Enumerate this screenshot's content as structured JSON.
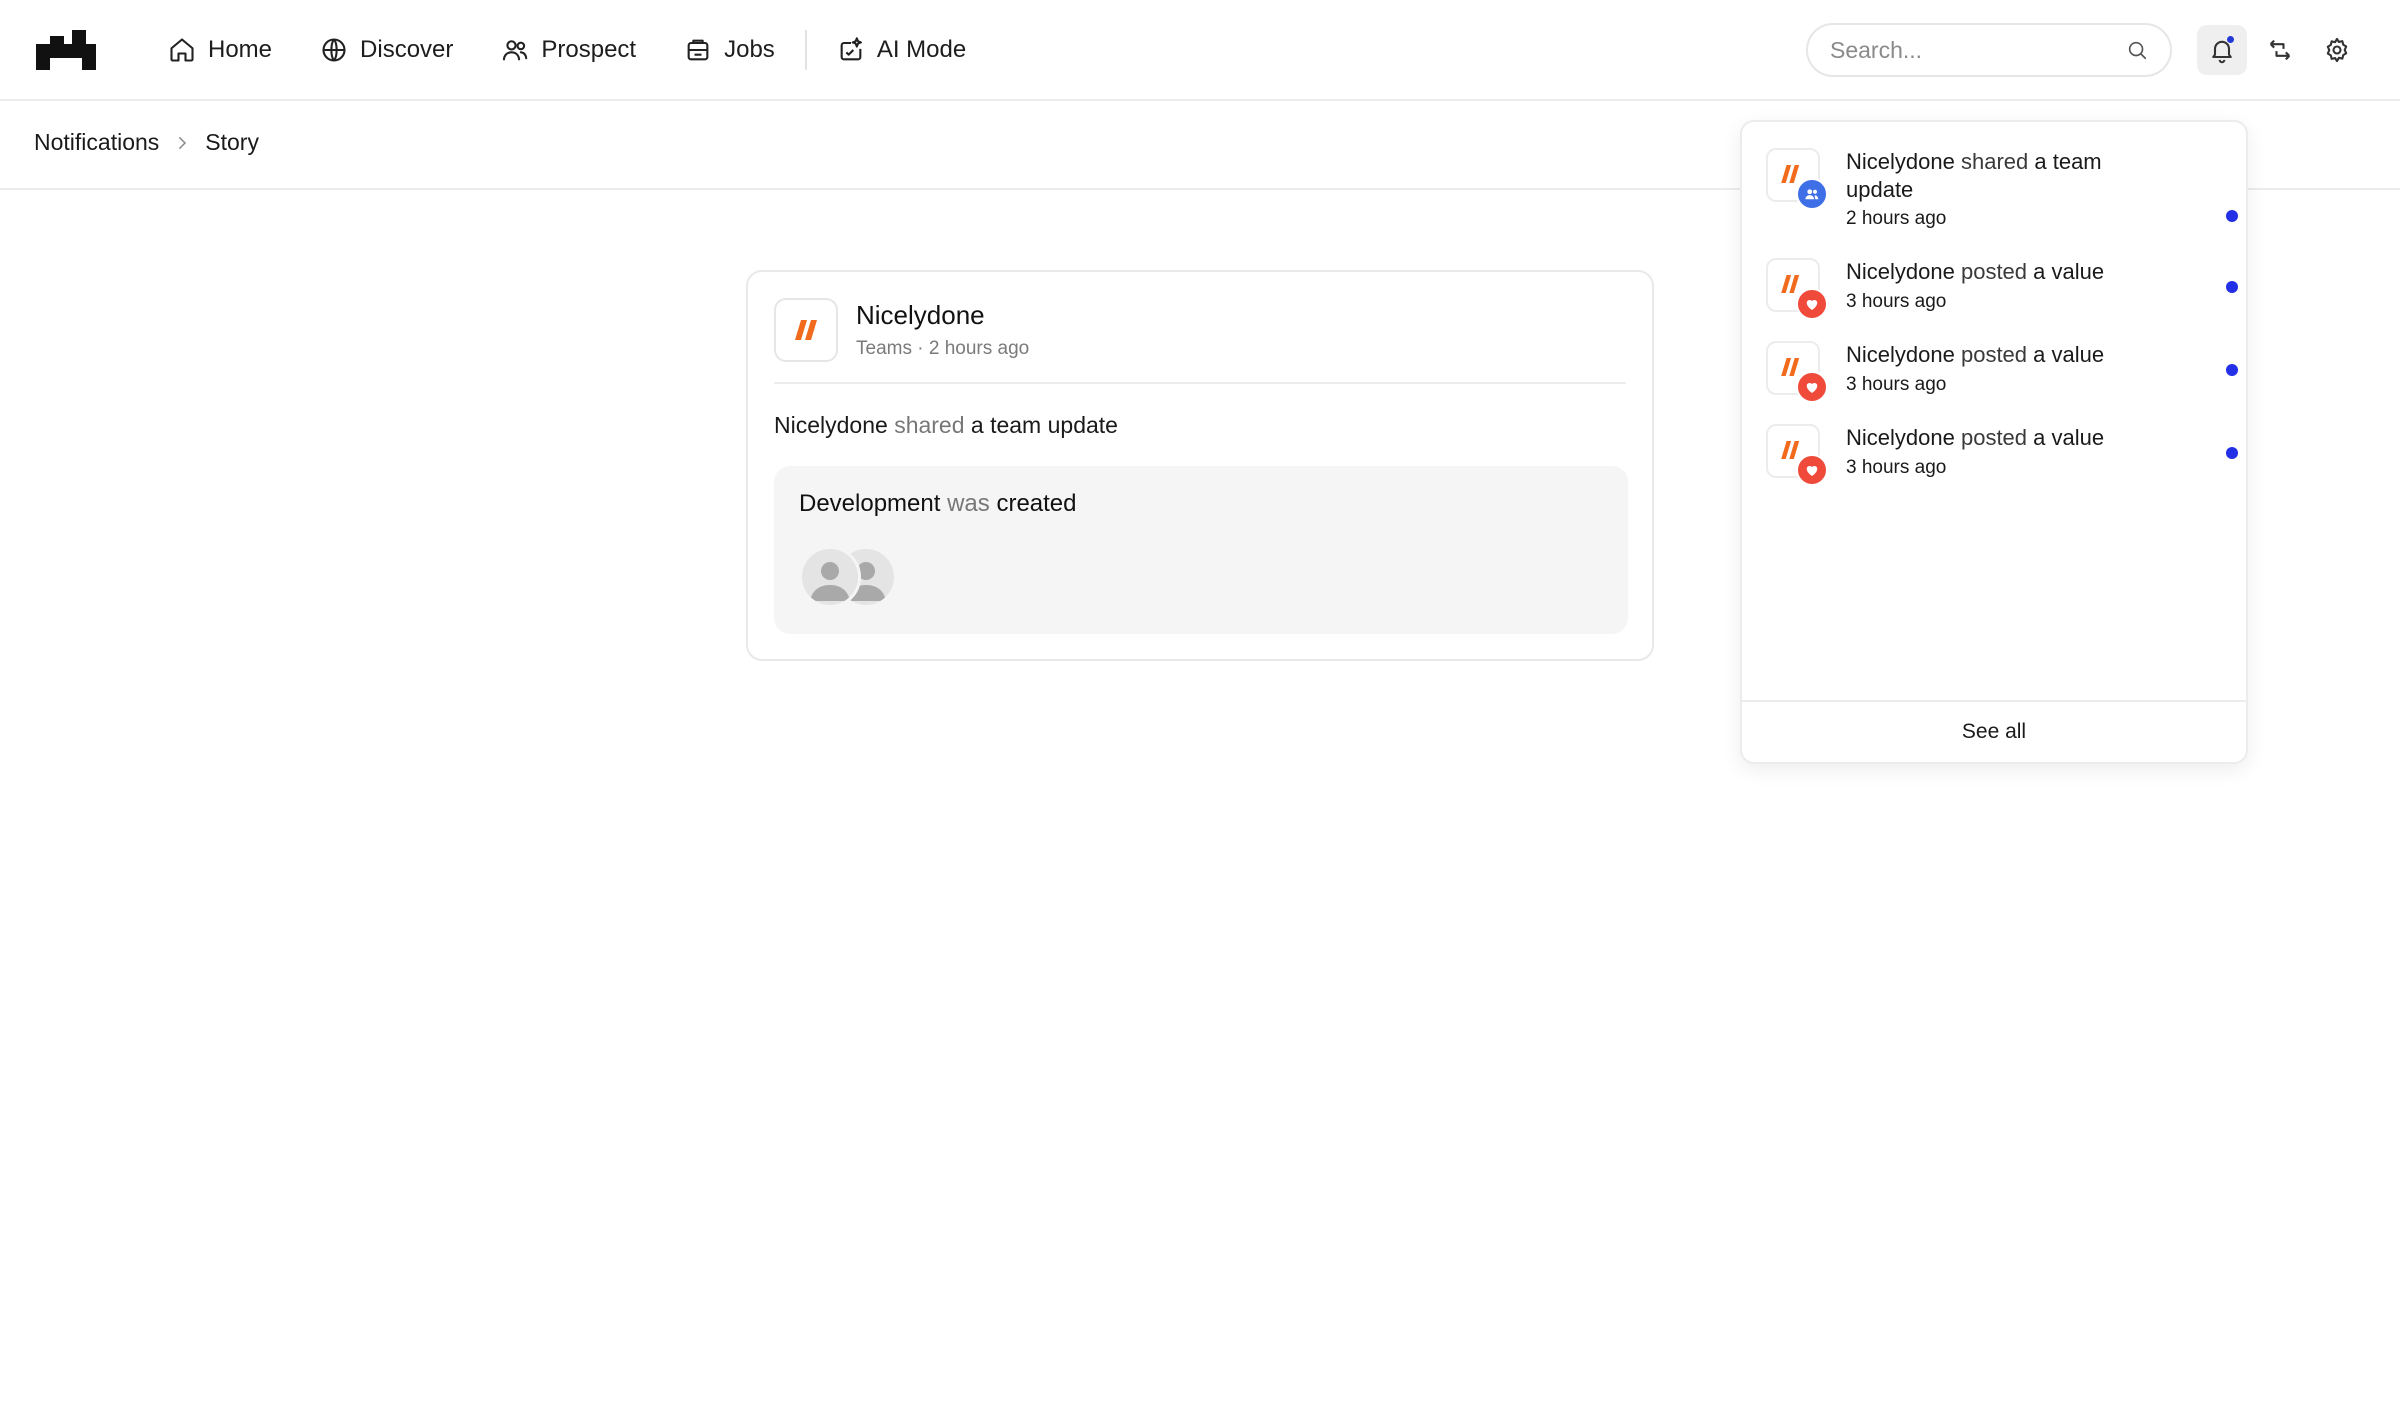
{
  "nav": {
    "logo": "brand-logo",
    "items": [
      {
        "label": "Home",
        "icon": "home-icon"
      },
      {
        "label": "Discover",
        "icon": "globe-icon"
      },
      {
        "label": "Prospect",
        "icon": "users-icon"
      },
      {
        "label": "Jobs",
        "icon": "briefcase-icon"
      },
      {
        "label": "AI Mode",
        "icon": "sparkle-icon"
      }
    ],
    "search_placeholder": "Search...",
    "has_unread": true
  },
  "breadcrumb": {
    "items": [
      "Notifications",
      "Story"
    ]
  },
  "story": {
    "company": "Nicelydone",
    "meta": "Teams · 2 hours ago",
    "line": {
      "actor": "Nicelydone",
      "verb": "shared",
      "object": "a team update"
    },
    "inner": {
      "subject": "Development",
      "verb": "was",
      "object": "created"
    },
    "avatar_count": 2
  },
  "notifications": {
    "items": [
      {
        "actor": "Nicelydone",
        "verb": "shared",
        "object": "a team update",
        "time": "2 hours ago",
        "badge": "team-icon",
        "unread": true
      },
      {
        "actor": "Nicelydone",
        "verb": "posted",
        "object": "a value",
        "time": "3 hours ago",
        "badge": "heart-icon",
        "unread": true
      },
      {
        "actor": "Nicelydone",
        "verb": "posted",
        "object": "a value",
        "time": "3 hours ago",
        "badge": "heart-icon",
        "unread": true
      },
      {
        "actor": "Nicelydone",
        "verb": "posted",
        "object": "a value",
        "time": "3 hours ago",
        "badge": "heart-icon",
        "unread": true
      }
    ],
    "see_all": "See all"
  },
  "colors": {
    "brand_orange": "#f26b1d",
    "unread_blue": "#2330e6",
    "team_badge": "#3f6fe6",
    "heart_badge": "#f04a3a"
  }
}
